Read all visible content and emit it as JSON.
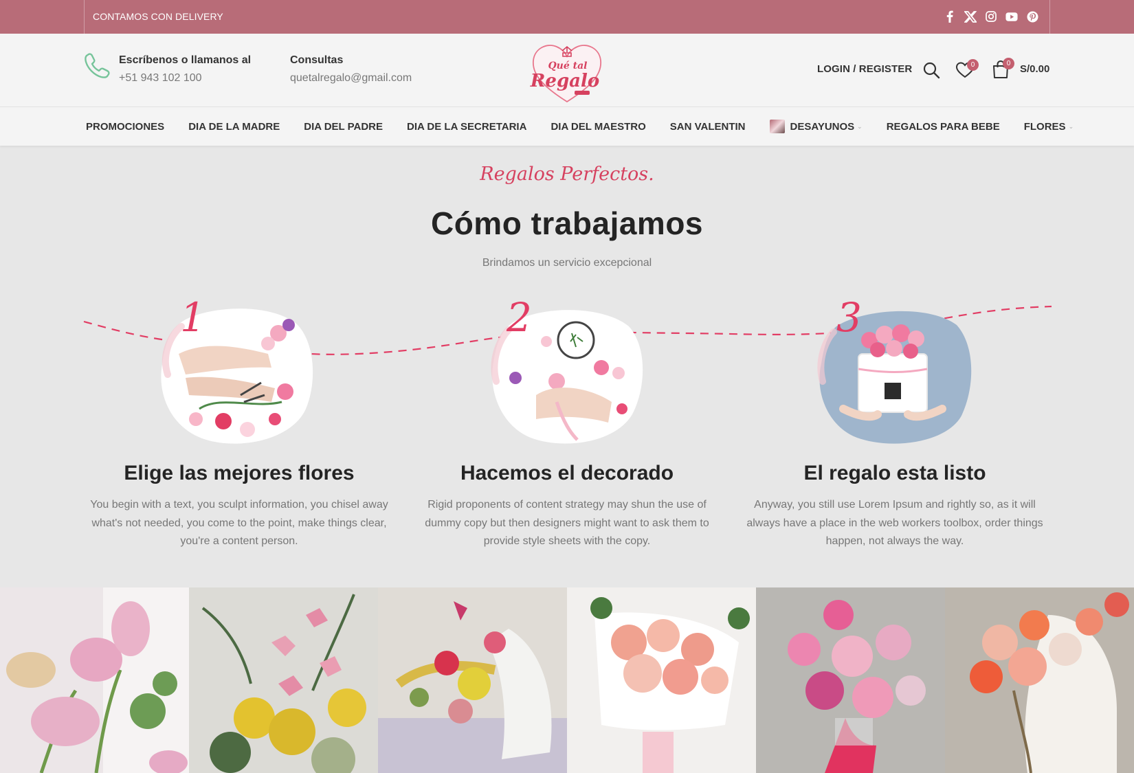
{
  "topbar": {
    "delivery_text": "CONTAMOS CON DELIVERY",
    "social_icons": [
      "facebook-icon",
      "x-icon",
      "instagram-icon",
      "youtube-icon",
      "pinterest-icon"
    ]
  },
  "header": {
    "contact_title": "Escríbenos o llamanos al",
    "contact_phone": "+51 943 102 100",
    "consult_title": "Consultas",
    "consult_email": "quetalregalo@gmail.com",
    "logo_line1": "Qué tal",
    "logo_line2": "Regalo",
    "login_label": "LOGIN / REGISTER",
    "wishlist_count": "0",
    "cart_count": "0",
    "cart_total": "S/0.00"
  },
  "nav": {
    "items": [
      {
        "label": "PROMOCIONES"
      },
      {
        "label": "DIA DE LA MADRE"
      },
      {
        "label": "DIA DEL PADRE"
      },
      {
        "label": "DIA DE LA SECRETARIA"
      },
      {
        "label": "DIA DEL MAESTRO"
      },
      {
        "label": "SAN VALENTIN"
      },
      {
        "label": "DESAYUNOS",
        "has_thumb": true,
        "dropdown": true
      },
      {
        "label": "REGALOS PARA BEBE"
      },
      {
        "label": "FLORES",
        "dropdown": true
      }
    ]
  },
  "section": {
    "script_title": "Regalos Perfectos.",
    "title": "Cómo trabajamos",
    "subtitle": "Brindamos un servicio excepcional",
    "steps": [
      {
        "number": "1",
        "title": "Elige las mejores flores",
        "text": "You begin with a text, you sculpt information, you chisel away what's not needed, you come to the point, make things clear, you're a content person."
      },
      {
        "number": "2",
        "title": "Hacemos el decorado",
        "text": "Rigid proponents of content strategy may shun the use of dummy copy but then designers might want to ask them to provide style sheets with the copy."
      },
      {
        "number": "3",
        "title": "El regalo esta listo",
        "text": "Anyway, you still use Lorem Ipsum and rightly so, as it will always have a place in the web workers toolbox, order things happen, not always the way."
      }
    ]
  },
  "colors": {
    "topbar": "#b86c78",
    "accent": "#e23d64",
    "background": "#e7e7e7"
  }
}
